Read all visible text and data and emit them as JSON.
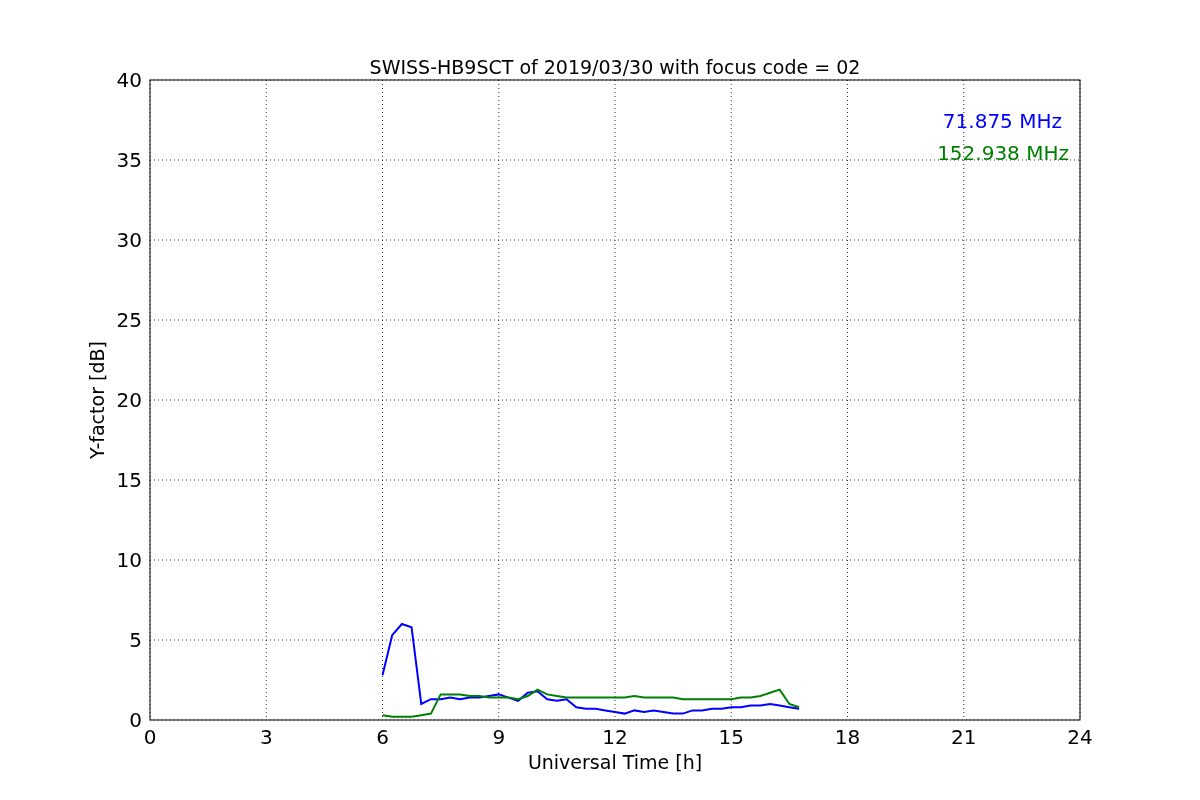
{
  "chart_data": {
    "type": "line",
    "title": "SWISS-HB9SCT of 2019/03/30 with focus code = 02",
    "xlabel": "Universal Time [h]",
    "ylabel": "Y-factor [dB]",
    "x": [
      6.0,
      6.25,
      6.5,
      6.75,
      7.0,
      7.25,
      7.5,
      7.75,
      8.0,
      8.25,
      8.5,
      8.75,
      9.0,
      9.25,
      9.5,
      9.75,
      10.0,
      10.25,
      10.5,
      10.75,
      11.0,
      11.25,
      11.5,
      11.75,
      12.0,
      12.25,
      12.5,
      12.75,
      13.0,
      13.25,
      13.5,
      13.75,
      14.0,
      14.25,
      14.5,
      14.75,
      15.0,
      15.25,
      15.5,
      15.75,
      16.0,
      16.25,
      16.5,
      16.75
    ],
    "series": [
      {
        "name": "71.875 MHz",
        "color": "#0000ff",
        "values": [
          2.8,
          5.3,
          6.0,
          5.8,
          1.0,
          1.3,
          1.3,
          1.4,
          1.3,
          1.4,
          1.4,
          1.5,
          1.6,
          1.4,
          1.2,
          1.7,
          1.8,
          1.3,
          1.2,
          1.3,
          0.8,
          0.7,
          0.7,
          0.6,
          0.5,
          0.4,
          0.6,
          0.5,
          0.6,
          0.5,
          0.4,
          0.4,
          0.6,
          0.6,
          0.7,
          0.7,
          0.8,
          0.8,
          0.9,
          0.9,
          1.0,
          0.9,
          0.8,
          0.7
        ]
      },
      {
        "name": "152.938 MHz",
        "color": "#008000",
        "values": [
          0.3,
          0.2,
          0.2,
          0.2,
          0.3,
          0.4,
          1.6,
          1.6,
          1.6,
          1.5,
          1.5,
          1.4,
          1.4,
          1.4,
          1.3,
          1.5,
          1.9,
          1.6,
          1.5,
          1.4,
          1.4,
          1.4,
          1.4,
          1.4,
          1.4,
          1.4,
          1.5,
          1.4,
          1.4,
          1.4,
          1.4,
          1.3,
          1.3,
          1.3,
          1.3,
          1.3,
          1.3,
          1.4,
          1.4,
          1.5,
          1.7,
          1.9,
          1.0,
          0.8
        ]
      }
    ],
    "xlim": [
      0,
      24
    ],
    "ylim": [
      0,
      40
    ],
    "xticks": [
      0,
      3,
      6,
      9,
      12,
      15,
      18,
      21,
      24
    ],
    "yticks": [
      0,
      5,
      10,
      15,
      20,
      25,
      30,
      35,
      40
    ],
    "grid": true
  }
}
